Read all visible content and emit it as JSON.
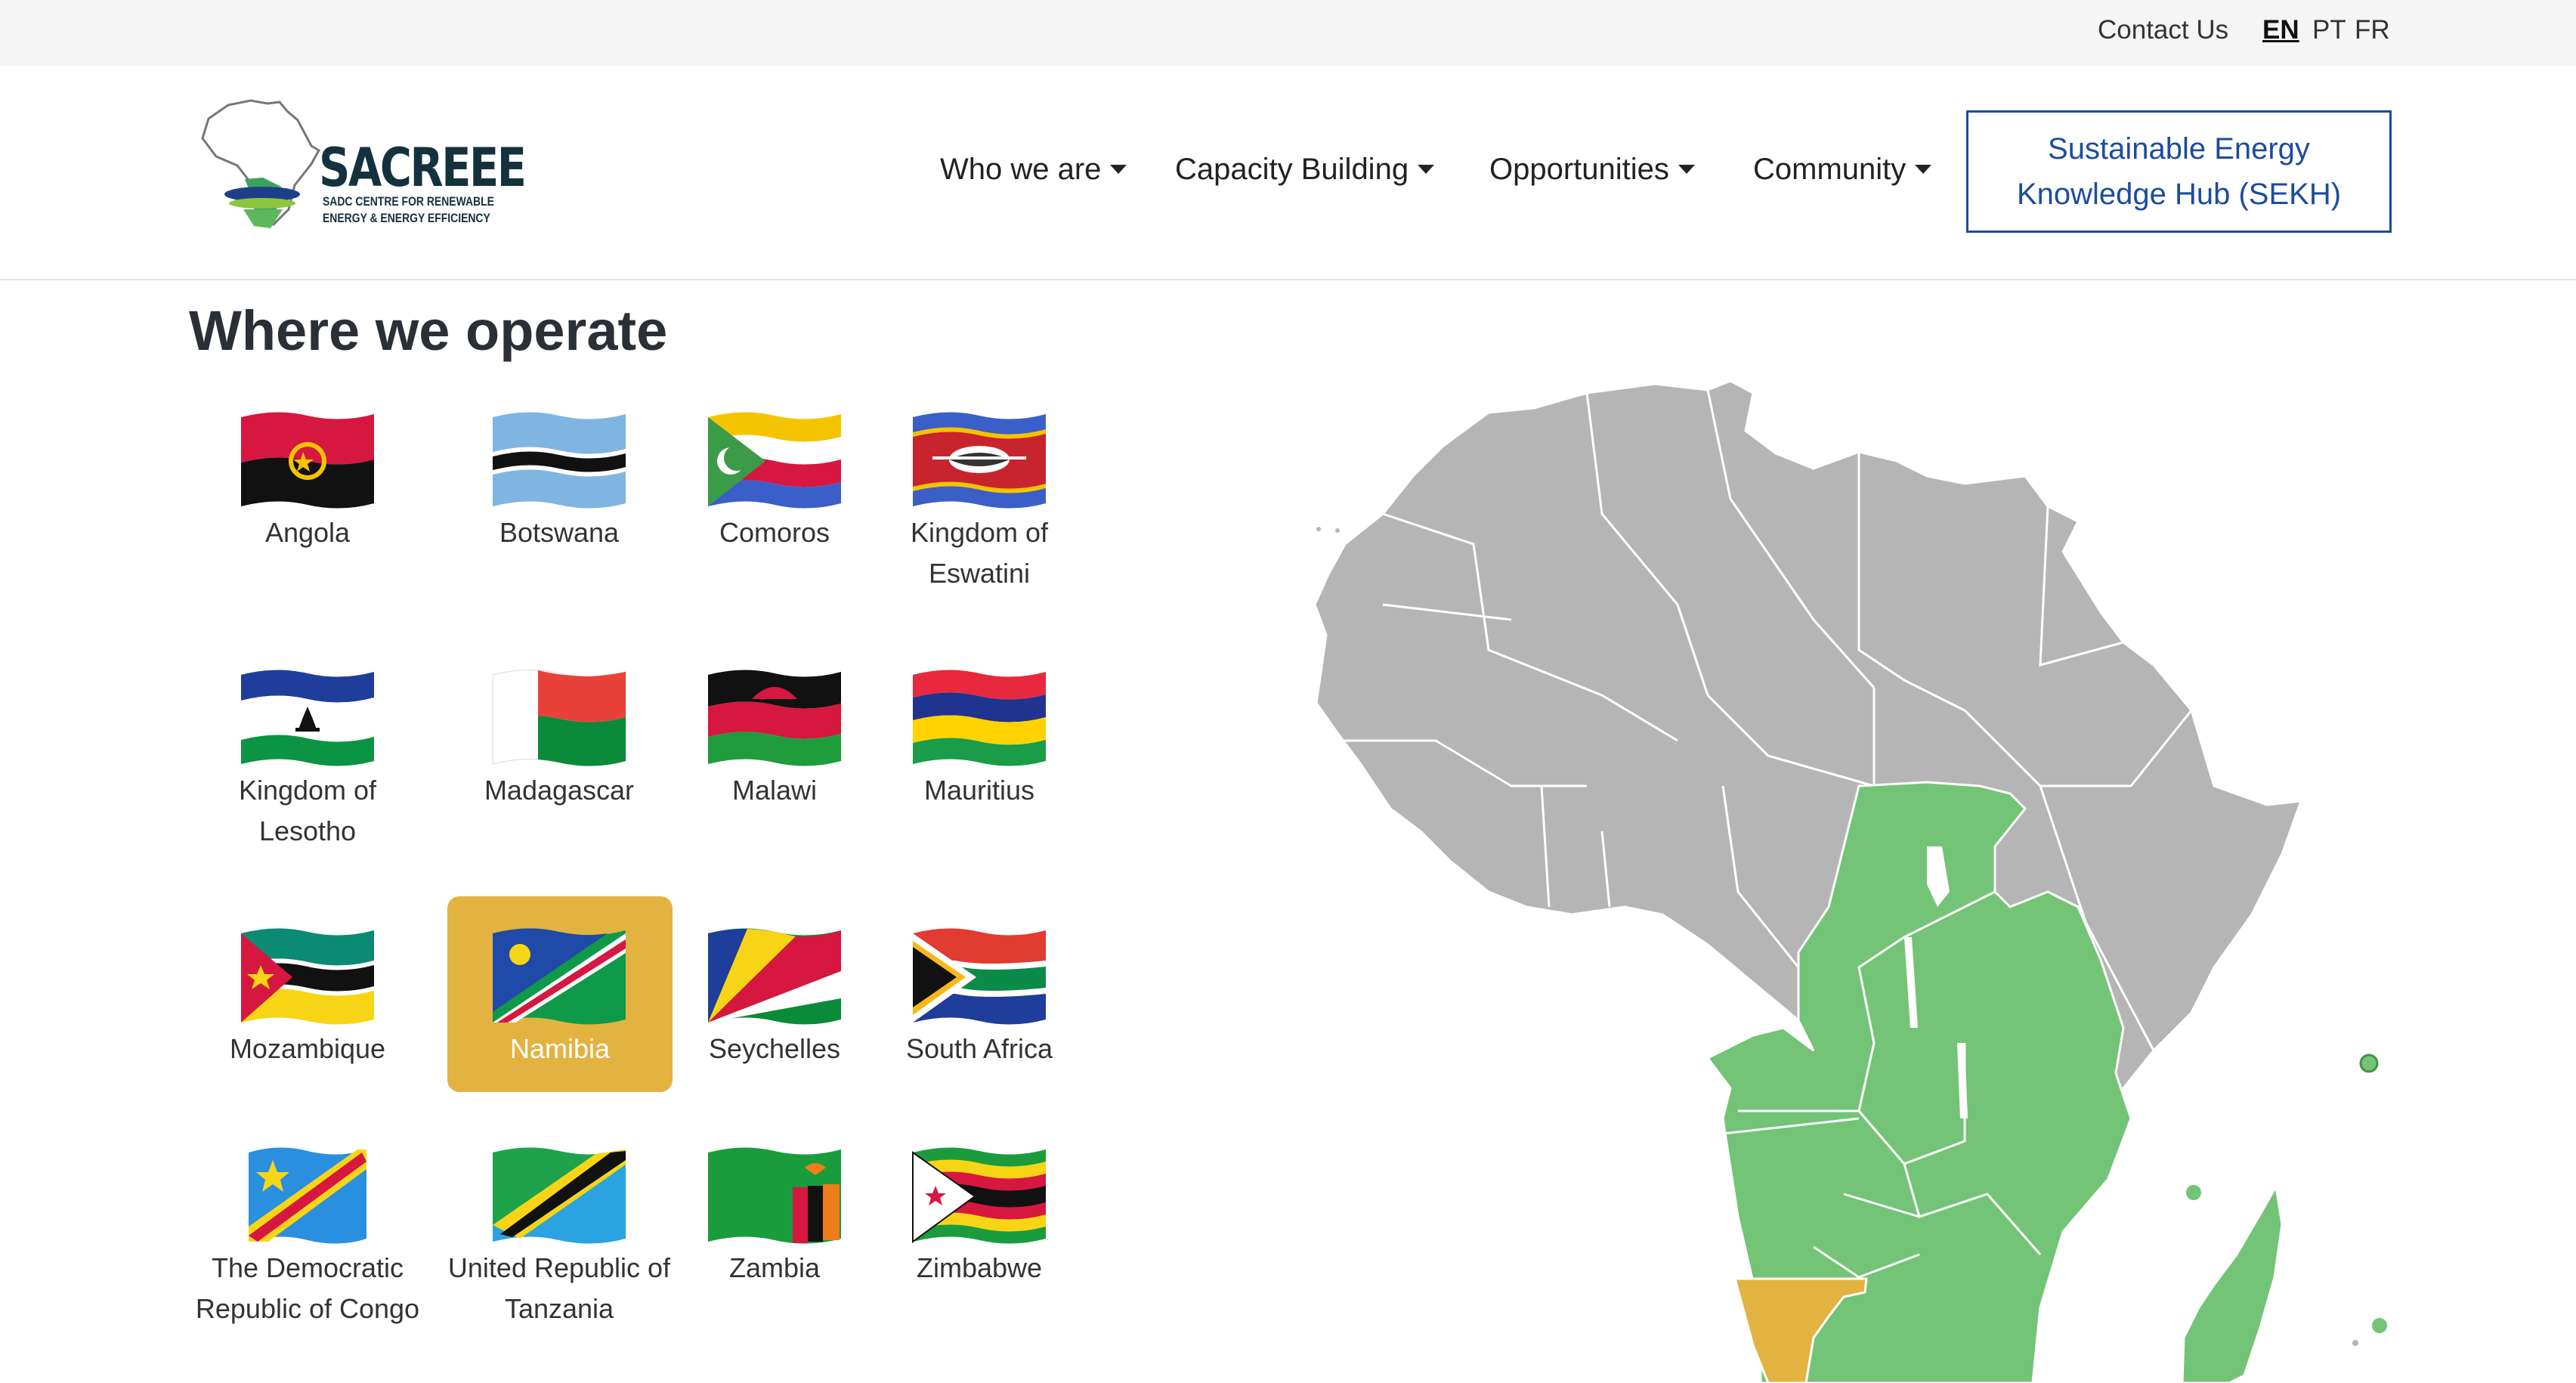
{
  "topbar": {
    "contact": "Contact Us",
    "languages": [
      "EN",
      "PT",
      "FR"
    ],
    "active_language": "EN"
  },
  "logo": {
    "brand": "SACREEE",
    "subtitle_line1": "SADC CENTRE FOR RENEWABLE",
    "subtitle_line2": "ENERGY & ENERGY EFFICIENCY"
  },
  "nav": {
    "items": [
      "Who we are",
      "Capacity Building",
      "Opportunities",
      "Community"
    ],
    "cta_line1": "Sustainable Energy",
    "cta_line2": "Knowledge Hub (SEKH)"
  },
  "page": {
    "title": "Where we operate"
  },
  "countries": [
    {
      "name": "Angola",
      "flag": "angola-flag"
    },
    {
      "name": "Botswana",
      "flag": "botswana-flag"
    },
    {
      "name": "Comoros",
      "flag": "comoros-flag"
    },
    {
      "name": "Kingdom of Eswatini",
      "flag": "eswatini-flag"
    },
    {
      "name": "Kingdom of Lesotho",
      "flag": "lesotho-flag"
    },
    {
      "name": "Madagascar",
      "flag": "madagascar-flag"
    },
    {
      "name": "Malawi",
      "flag": "malawi-flag"
    },
    {
      "name": "Mauritius",
      "flag": "mauritius-flag"
    },
    {
      "name": "Mozambique",
      "flag": "mozambique-flag"
    },
    {
      "name": "Namibia",
      "flag": "namibia-flag"
    },
    {
      "name": "Seychelles",
      "flag": "seychelles-flag"
    },
    {
      "name": "South Africa",
      "flag": "south-africa-flag"
    },
    {
      "name": "The Democratic Republic of Congo",
      "flag": "drc-flag"
    },
    {
      "name": "United Republic of Tanzania",
      "flag": "tanzania-flag"
    },
    {
      "name": "Zambia",
      "flag": "zambia-flag"
    },
    {
      "name": "Zimbabwe",
      "flag": "zimbabwe-flag"
    }
  ],
  "selected_country": "Namibia",
  "colors": {
    "selected": "#e3b341",
    "sadc_region": "#73c476",
    "other_region": "#b5b5b5",
    "link": "#1c4c9c"
  }
}
